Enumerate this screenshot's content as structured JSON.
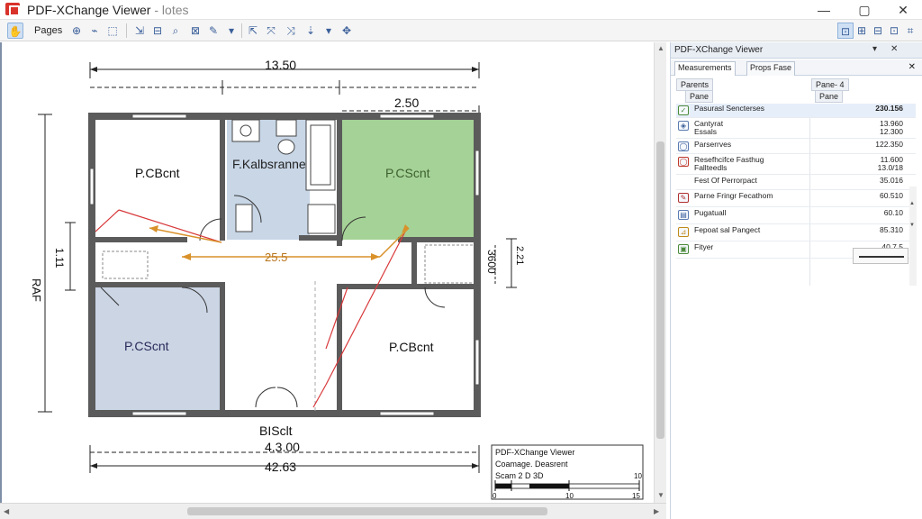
{
  "window": {
    "title_main": "PDF-XChange Viewer",
    "title_sub": " - lotes",
    "minimize": "—",
    "maximize": "▢",
    "close": "✕"
  },
  "toolbar": {
    "pages_label": "Pages"
  },
  "plan": {
    "dim_top": "13.50",
    "dim_top_right": "2.50",
    "dim_left": "RAF",
    "dim_left_small": "1.11",
    "dim_right": "3600",
    "dim_right_small": "2.21",
    "dim_center": "25.5",
    "room_top_left": "P.CBcnt",
    "room_top_center": "F.Kalbsranne",
    "room_top_right": "P.CScnt",
    "room_bottom_left": "P.CScnt",
    "room_bottom_right": "P.CBcnt",
    "bottom_label": "BISclt",
    "dim_bottom_1": "4.3.00",
    "dim_bottom_2": "42.63",
    "room_top_right_color": "#a5d296",
    "room_bottom_left_color": "#cbd5e4",
    "room_center_color": "#c8d6e6",
    "annotation_color": "#d8393b",
    "arrow_color": "#d9912a"
  },
  "title_block": {
    "line1": "PDF-XChange Viewer",
    "line2": "Coamage. Deasrent",
    "line3": "Scam 2 D 3D",
    "scale_start": "0",
    "scale_mid": "10",
    "scale_end": "15",
    "scale_top": "10"
  },
  "panel": {
    "title": "PDF-XChange Viewer",
    "pin": "▾",
    "close": "✕",
    "tab_measurements": "Measurements",
    "tab_properties": "Props Fase",
    "tab_close": "✕",
    "header_left_1": "Parents",
    "header_left_2": "Pane",
    "header_right_1": "Pane- 4",
    "header_right_2": "Pane",
    "rows": [
      {
        "name": "Pasurasl Sencterses",
        "value": "230.156"
      },
      {
        "name": "Cantyrat\nEssals",
        "value": "13.960\n12.300"
      },
      {
        "name": "Parserrves",
        "value": "122.350"
      },
      {
        "name": "Resefhcifce Fasthug\nFallteedls",
        "value": "11.600\n13.0/18"
      },
      {
        "name": "Fest Of Perrorpact",
        "value": "35.016"
      },
      {
        "name": "Parne Fringr Fecathom",
        "value": "60.510"
      },
      {
        "name": "Pugatuall",
        "value": "60.10"
      },
      {
        "name": "Fepoat sal Pangect",
        "value": "85.310"
      },
      {
        "name": "Fityer",
        "value": "40.7.5"
      }
    ]
  }
}
